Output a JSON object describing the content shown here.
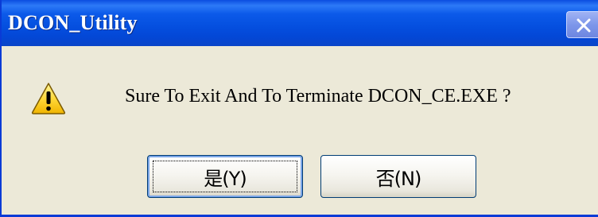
{
  "window": {
    "title": "DCON_Utility"
  },
  "titlebar": {
    "close_icon": "close-icon"
  },
  "dialog": {
    "icon": "warning-icon",
    "message": "Sure To Exit And To Terminate DCON_CE.EXE ?"
  },
  "buttons": {
    "yes_label": "是(Y)",
    "no_label": "否(N)"
  }
}
